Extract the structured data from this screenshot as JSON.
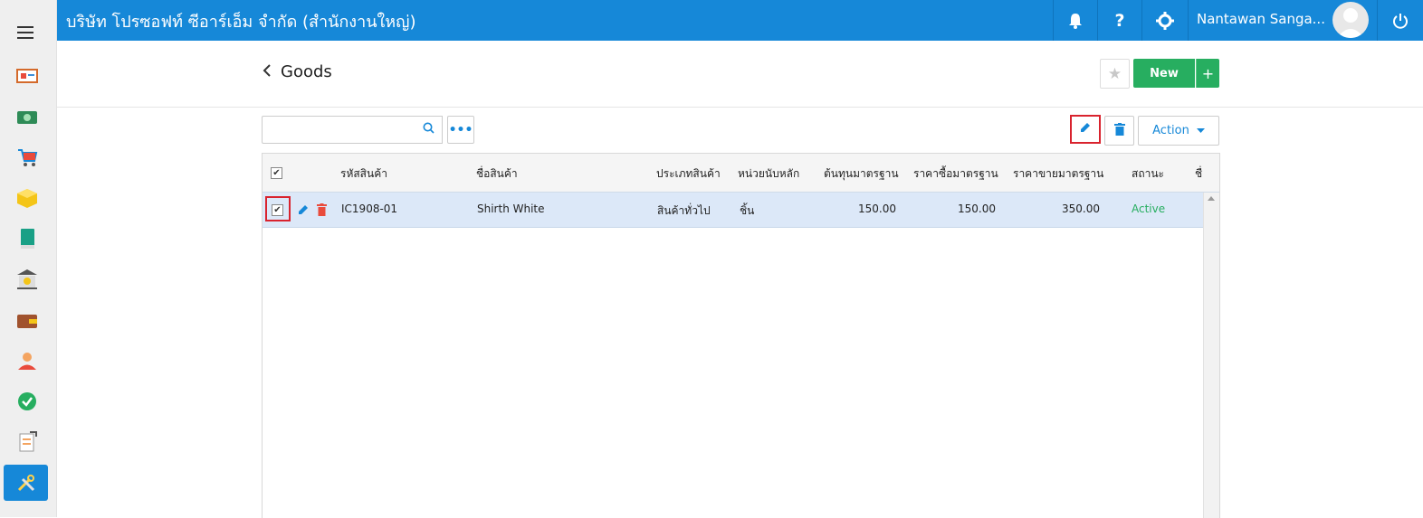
{
  "app": {
    "company_name": "บริษัท โปรซอฟท์ ซีอาร์เอ็ม จำกัด (สำนักงานใหญ่)",
    "user_name": "Nantawan Sanga..."
  },
  "topbar_icons": [
    "bell-icon",
    "help-icon",
    "settings-icon",
    "power-icon"
  ],
  "topbar_help_glyph": "?",
  "sidebar": {
    "items": [
      {
        "icon": "dashboard-icon"
      },
      {
        "icon": "money-icon"
      },
      {
        "icon": "cart-icon"
      },
      {
        "icon": "box-icon"
      },
      {
        "icon": "book-icon"
      },
      {
        "icon": "bank-icon"
      },
      {
        "icon": "wallet-icon"
      },
      {
        "icon": "people-icon"
      },
      {
        "icon": "check-icon"
      },
      {
        "icon": "report-icon"
      },
      {
        "icon": "tools-icon"
      }
    ]
  },
  "page": {
    "title": "Goods",
    "new_label": "New",
    "plus_label": "+"
  },
  "toolbar": {
    "search_value": "",
    "more_label": "•••",
    "action_label": "Action"
  },
  "grid": {
    "columns": [
      "รหัสสินค้า",
      "ชื่อสินค้า",
      "ประเภทสินค้า",
      "หน่วยนับหลัก",
      "ต้นทุนมาตรฐาน",
      "ราคาซื้อมาตรฐาน",
      "ราคาขายมาตรฐาน",
      "สถานะ",
      "ชื่"
    ],
    "rows": [
      {
        "code": "IC1908-01",
        "name": "Shirth White",
        "type": "สินค้าทั่วไป",
        "unit": "ชิ้น",
        "cost": "150.00",
        "buy_price": "150.00",
        "sell_price": "350.00",
        "status": "Active",
        "checked": true
      }
    ]
  },
  "colors": {
    "brand_blue": "#1688d8",
    "new_green": "#27ae60",
    "highlight_red": "#d9232e",
    "active_green": "#27ae60",
    "selected_row": "#dce8f8"
  }
}
